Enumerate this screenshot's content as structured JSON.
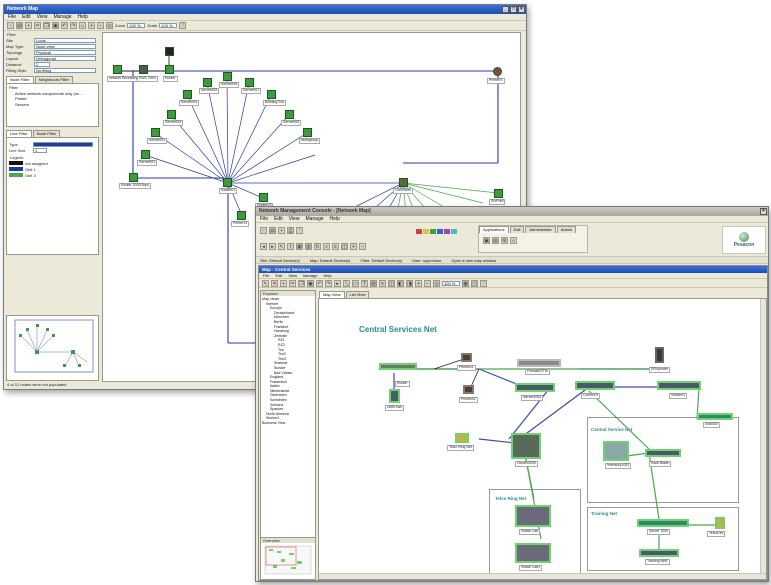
{
  "back_window": {
    "title": "Network Map",
    "menu": [
      "File",
      "Edit",
      "View",
      "Manage",
      "Help"
    ],
    "toolbar_zoom_label": "Zoom",
    "toolbar_zoom_value": "100 %",
    "toolbar_scale_label": "Scale",
    "toolbar_scale_value": "100 %",
    "filter_title": "Filter",
    "fields": [
      {
        "label": "Site",
        "value": "Local"
      },
      {
        "label": "Map Type",
        "value": "Node view"
      },
      {
        "label": "Topology",
        "value": "Physical"
      },
      {
        "label": "Layout",
        "value": "Orthogonal"
      },
      {
        "label": "Distance",
        "value": "2"
      },
      {
        "label": "Filling Style",
        "value": "No filling"
      }
    ],
    "tabs_top": [
      "Node Filter",
      "Neighbours Filter"
    ],
    "filter_tree": [
      "Filter",
      "Active network components only (no ...",
      "Printer",
      "Servers"
    ],
    "tabs_bottom": [
      "Line Filter",
      "Node Filter"
    ],
    "line_type_label": "Type",
    "line_size_label": "Line Size",
    "line_size_value": "1",
    "legend_title": "Legend",
    "legend": [
      {
        "label": "not assigned",
        "color": "#111111"
      },
      {
        "label": "Gbit 1",
        "color": "#2233aa"
      },
      {
        "label": "Gbit 3",
        "color": "#4aa84a"
      }
    ],
    "status": "4 of 12 nodes were not populated",
    "nodes_top": [
      "network Boundary",
      "SWC 2001",
      "Router",
      "Printer/S"
    ],
    "nodes_fan": [
      "Server001",
      "Server002",
      "Server003",
      "Server004",
      "Server005",
      "Server006",
      "Server007",
      "Building Svc",
      "Server009",
      "Workgroup"
    ],
    "nodes_mid": [
      "Router 1000/1bps",
      "Switch01",
      "Core/Nets",
      "Router03",
      "Printer14",
      "SrvPrint"
    ]
  },
  "front_window": {
    "title": "Network Management Console - [Network Map]",
    "menu_top": [
      "File",
      "Edit",
      "View",
      "Manage",
      "Help"
    ],
    "ribbon_tabs": [
      "Applications",
      "Edit",
      "Administrate",
      "Admin"
    ],
    "status_items": [
      "Site: Default Device(s)",
      "Map: Default Device(s)",
      "Filter: Default Device(s)",
      "User: supervisor",
      "Open a new map window"
    ],
    "logo_text": "Pesacon",
    "inner_title": "Map - Central Services",
    "inner_menu": [
      "File",
      "Edit",
      "View",
      "Manage",
      "Help"
    ],
    "zoom_value": "100 %",
    "tabs": [
      "Map View",
      "List View"
    ],
    "explorer_title": "Explorer",
    "tree": [
      {
        "label": "Map views",
        "indent": 0
      },
      {
        "label": "Internet",
        "indent": 1
      },
      {
        "label": "Europe",
        "indent": 2
      },
      {
        "label": "Deutschland",
        "indent": 3
      },
      {
        "label": "München",
        "indent": 3
      },
      {
        "label": "Berlin",
        "indent": 3
      },
      {
        "label": "Frankfurt",
        "indent": 3
      },
      {
        "label": "Hamburg",
        "indent": 3
      },
      {
        "label": "Zentrale",
        "indent": 3
      },
      {
        "label": "RZ1",
        "indent": 4
      },
      {
        "label": "RZ2",
        "indent": 4
      },
      {
        "label": "Trw",
        "indent": 4
      },
      {
        "label": "Trw2",
        "indent": 4
      },
      {
        "label": "Trw3",
        "indent": 4
      },
      {
        "label": "Shahnet",
        "indent": 3
      },
      {
        "label": "Sunder",
        "indent": 3
      },
      {
        "label": "Bad Vöslau",
        "indent": 3
      },
      {
        "label": "England",
        "indent": 2
      },
      {
        "label": "Frankreich",
        "indent": 2
      },
      {
        "label": "Italien",
        "indent": 2
      },
      {
        "label": "Niederlande",
        "indent": 2
      },
      {
        "label": "Österreich",
        "indent": 2
      },
      {
        "label": "Schweden",
        "indent": 2
      },
      {
        "label": "Schweiz",
        "indent": 2
      },
      {
        "label": "Spanien",
        "indent": 2
      },
      {
        "label": "North America",
        "indent": 1
      },
      {
        "label": "Worker1",
        "indent": 1
      },
      {
        "label": "Business View",
        "indent": 0
      }
    ],
    "overview_label": "Overview",
    "map_title": "Central Services Net",
    "groups": [
      "Central Service Net",
      "Telco Ring Net",
      "Training Net"
    ],
    "devices": [
      "Router",
      "PrinterA1",
      "Firewall/DTM",
      "SRVprinter",
      "PrinterA2",
      "Server4004",
      "Core4001",
      "Switch01",
      "UMB hub",
      "Cluster4000",
      "Telco Ring Net",
      "Sw6000",
      "Switch Lab",
      "Switch Lab2",
      "Inventory1000",
      "Rack Blade",
      "Server 1000",
      "TelcoDev",
      "Training Net1",
      "Server1"
    ]
  }
}
